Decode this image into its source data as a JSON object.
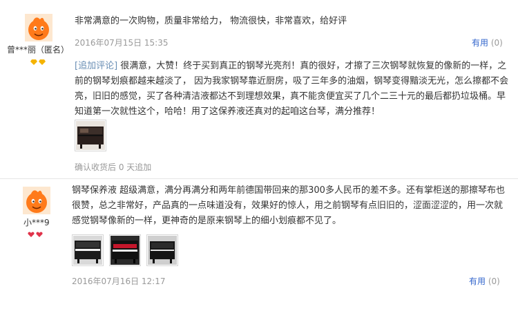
{
  "reviews": [
    {
      "username": "曾***丽（匿名）",
      "badge_color": "#f5b400",
      "content": "非常满意的一次购物，质量非常给力， 物流很快，非常喜欢，给好评",
      "date": "2016年07月15日 15:35",
      "useful_label": "有用",
      "useful_count": "(0)",
      "append": {
        "tag": "[追加评论]",
        "text": "很满意，大赞！终于买到真正的钢琴光亮剂！真的很好，才擦了三次钢琴就恢复的像新的一样，之前的钢琴划痕都越来越淡了， 因为我家钢琴靠近厨房，吸了三年多的油烟，钢琴变得黯淡无光，怎么擦都不会亮，旧旧的感觉，买了各种清洁液都达不到理想效果，真不能贪便宜买了几个二三十元的最后都扔垃圾桶。早知道第一次就性这个，哈哈！用了这保养液还真对的起咱这台琴，满分推荐！",
        "meta": "确认收货后 0 天追加"
      }
    },
    {
      "username": "小***9",
      "badge_color": "#e0334a",
      "content": "钢琴保养液 超级满意，满分再满分和两年前德国带回来的那300多人民币的差不多。还有掌柜送的那擦琴布也很赞，总之非常好，产品真的一点味道没有，效果好的惊人，用之前钢琴有点旧旧的，涩面涩涩的，用一次就感觉钢琴像新的一样，更神奇的是原来钢琴上的细小划痕都不见了。",
      "date": "2016年07月16日 12:17",
      "useful_label": "有用",
      "useful_count": "(0)"
    }
  ]
}
